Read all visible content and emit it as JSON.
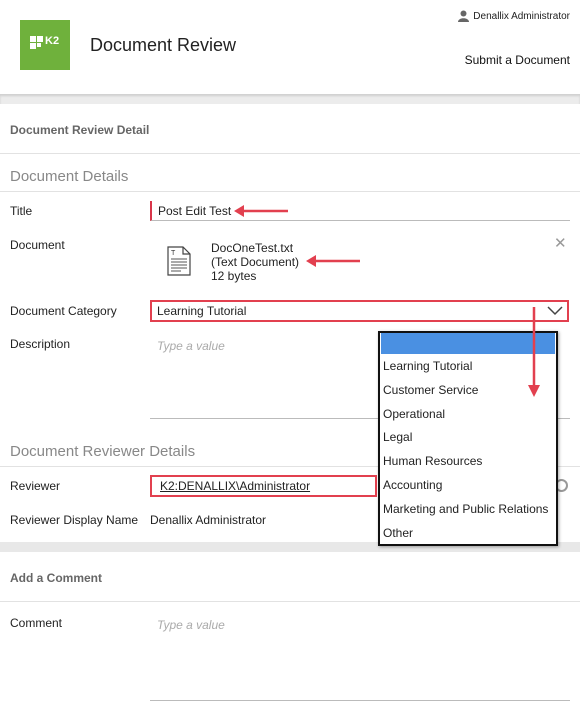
{
  "header": {
    "app_title": "Document Review",
    "logo_text": "K2",
    "user_name": "Denallix Administrator",
    "submit_link": "Submit a Document"
  },
  "sections": {
    "detail_header": "Document Review Detail",
    "document_details": "Document Details",
    "reviewer_details": "Document Reviewer Details",
    "comment_header": "Add a Comment"
  },
  "form": {
    "title_label": "Title",
    "title_value": "Post Edit Test",
    "document_label": "Document",
    "document_file": {
      "name": "DocOneTest.txt",
      "type": "(Text Document)",
      "size": "12 bytes"
    },
    "category_label": "Document Category",
    "category_value": "Learning Tutorial",
    "description_label": "Description",
    "description_placeholder": "Type a value",
    "reviewer_label": "Reviewer",
    "reviewer_value": "K2:DENALLIX\\Administrator",
    "reviewer_display_label": "Reviewer Display Name",
    "reviewer_display_value": "Denallix Administrator",
    "comment_label": "Comment",
    "comment_placeholder": "Type a value"
  },
  "category_dropdown": {
    "options": [
      "Learning Tutorial",
      "Customer Service",
      "Operational",
      "Legal",
      "Human Resources",
      "Accounting",
      "Marketing and Public Relations",
      "Other"
    ]
  },
  "colors": {
    "logo_green": "#6fb13c",
    "annotation_red": "#e2404f",
    "dropdown_highlight": "#4a90e2"
  }
}
